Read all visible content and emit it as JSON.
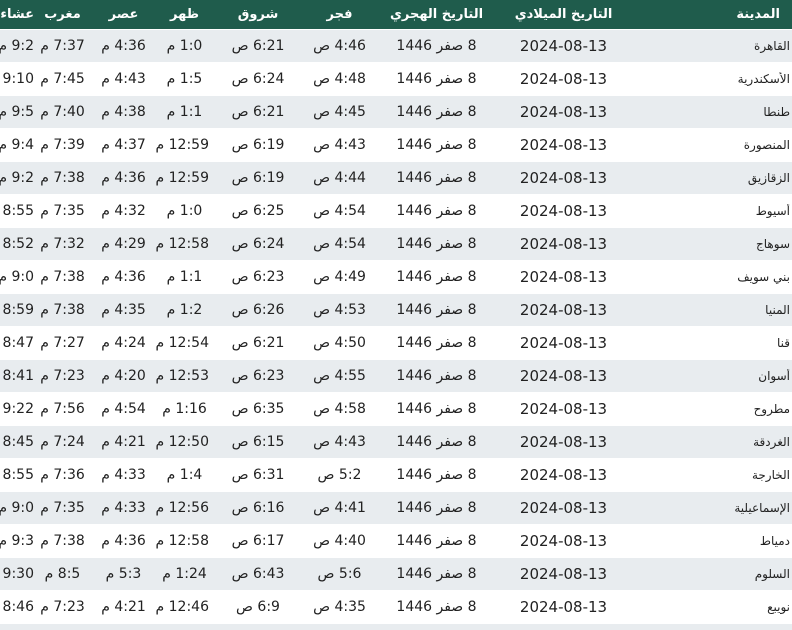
{
  "headers": {
    "city": "المدينة",
    "gregorian": "التاريخ الميلادي",
    "hijri": "التاريخ الهجري",
    "fajr": "فجر",
    "shuruq": "شروق",
    "dhuhr": "ظهر",
    "asr": "عصر",
    "maghrib": "مغرب",
    "isha": "عشاء"
  },
  "colors": {
    "header_bg": "#1f5c4c",
    "stripe_bg": "#e8ecef"
  },
  "rows": [
    {
      "city": "القاهرة",
      "gregorian": "2024-08-13",
      "hijri": "8 صفر 1446",
      "fajr": "4:46 ص",
      "shuruq": "6:21 ص",
      "dhuhr": "1:0 م",
      "asr": "4:36 م",
      "maghrib": "7:37 م",
      "isha": "9:2 م"
    },
    {
      "city": "الأسكندرية",
      "gregorian": "2024-08-13",
      "hijri": "8 صفر 1446",
      "fajr": "4:48 ص",
      "shuruq": "6:24 ص",
      "dhuhr": "1:5 م",
      "asr": "4:43 م",
      "maghrib": "7:45 م",
      "isha": "9:10 م"
    },
    {
      "city": "طنطا",
      "gregorian": "2024-08-13",
      "hijri": "8 صفر 1446",
      "fajr": "4:45 ص",
      "shuruq": "6:21 ص",
      "dhuhr": "1:1 م",
      "asr": "4:38 م",
      "maghrib": "7:40 م",
      "isha": "9:5 م"
    },
    {
      "city": "المنصورة",
      "gregorian": "2024-08-13",
      "hijri": "8 صفر 1446",
      "fajr": "4:43 ص",
      "shuruq": "6:19 ص",
      "dhuhr": "12:59 م",
      "asr": "4:37 م",
      "maghrib": "7:39 م",
      "isha": "9:4 م"
    },
    {
      "city": "الزقازيق",
      "gregorian": "2024-08-13",
      "hijri": "8 صفر 1446",
      "fajr": "4:44 ص",
      "shuruq": "6:19 ص",
      "dhuhr": "12:59 م",
      "asr": "4:36 م",
      "maghrib": "7:38 م",
      "isha": "9:2 م"
    },
    {
      "city": "أسيوط",
      "gregorian": "2024-08-13",
      "hijri": "8 صفر 1446",
      "fajr": "4:54 ص",
      "shuruq": "6:25 ص",
      "dhuhr": "1:0 م",
      "asr": "4:32 م",
      "maghrib": "7:35 م",
      "isha": "8:55 م"
    },
    {
      "city": "سوهاج",
      "gregorian": "2024-08-13",
      "hijri": "8 صفر 1446",
      "fajr": "4:54 ص",
      "shuruq": "6:24 ص",
      "dhuhr": "12:58 م",
      "asr": "4:29 م",
      "maghrib": "7:32 م",
      "isha": "8:52 م"
    },
    {
      "city": "بني سويف",
      "gregorian": "2024-08-13",
      "hijri": "8 صفر 1446",
      "fajr": "4:49 ص",
      "shuruq": "6:23 ص",
      "dhuhr": "1:1 م",
      "asr": "4:36 م",
      "maghrib": "7:38 م",
      "isha": "9:0 م"
    },
    {
      "city": "المنيا",
      "gregorian": "2024-08-13",
      "hijri": "8 صفر 1446",
      "fajr": "4:53 ص",
      "shuruq": "6:26 ص",
      "dhuhr": "1:2 م",
      "asr": "4:35 م",
      "maghrib": "7:38 م",
      "isha": "8:59 م"
    },
    {
      "city": "قنا",
      "gregorian": "2024-08-13",
      "hijri": "8 صفر 1446",
      "fajr": "4:50 ص",
      "shuruq": "6:21 ص",
      "dhuhr": "12:54 م",
      "asr": "4:24 م",
      "maghrib": "7:27 م",
      "isha": "8:47 م"
    },
    {
      "city": "أسوان",
      "gregorian": "2024-08-13",
      "hijri": "8 صفر 1446",
      "fajr": "4:55 ص",
      "shuruq": "6:23 ص",
      "dhuhr": "12:53 م",
      "asr": "4:20 م",
      "maghrib": "7:23 م",
      "isha": "8:41 م"
    },
    {
      "city": "مطروح",
      "gregorian": "2024-08-13",
      "hijri": "8 صفر 1446",
      "fajr": "4:58 ص",
      "shuruq": "6:35 ص",
      "dhuhr": "1:16 م",
      "asr": "4:54 م",
      "maghrib": "7:56 م",
      "isha": "9:22 م"
    },
    {
      "city": "الغردقة",
      "gregorian": "2024-08-13",
      "hijri": "8 صفر 1446",
      "fajr": "4:43 ص",
      "shuruq": "6:15 ص",
      "dhuhr": "12:50 م",
      "asr": "4:21 م",
      "maghrib": "7:24 م",
      "isha": "8:45 م"
    },
    {
      "city": "الخارجة",
      "gregorian": "2024-08-13",
      "hijri": "8 صفر 1446",
      "fajr": "5:2 ص",
      "shuruq": "6:31 ص",
      "dhuhr": "1:4 م",
      "asr": "4:33 م",
      "maghrib": "7:36 م",
      "isha": "8:55 م"
    },
    {
      "city": "الإسماعيلية",
      "gregorian": "2024-08-13",
      "hijri": "8 صفر 1446",
      "fajr": "4:41 ص",
      "shuruq": "6:16 ص",
      "dhuhr": "12:56 م",
      "asr": "4:33 م",
      "maghrib": "7:35 م",
      "isha": "9:0 م"
    },
    {
      "city": "دمياط",
      "gregorian": "2024-08-13",
      "hijri": "8 صفر 1446",
      "fajr": "4:40 ص",
      "shuruq": "6:17 ص",
      "dhuhr": "12:58 م",
      "asr": "4:36 م",
      "maghrib": "7:38 م",
      "isha": "9:3 م"
    },
    {
      "city": "السلوم",
      "gregorian": "2024-08-13",
      "hijri": "8 صفر 1446",
      "fajr": "5:6 ص",
      "shuruq": "6:43 ص",
      "dhuhr": "1:24 م",
      "asr": "5:3 م",
      "maghrib": "8:5 م",
      "isha": "9:30 م"
    },
    {
      "city": "نويبع",
      "gregorian": "2024-08-13",
      "hijri": "8 صفر 1446",
      "fajr": "4:35 ص",
      "shuruq": "6:9 ص",
      "dhuhr": "12:46 م",
      "asr": "4:21 م",
      "maghrib": "7:23 م",
      "isha": "8:46 م"
    }
  ]
}
